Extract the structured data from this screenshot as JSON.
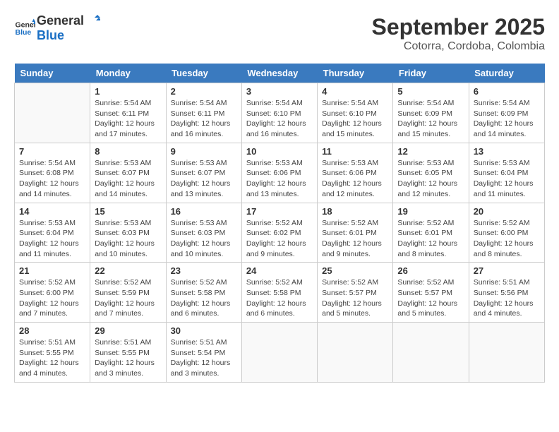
{
  "header": {
    "logo_line1": "General",
    "logo_line2": "Blue",
    "month": "September 2025",
    "location": "Cotorra, Cordoba, Colombia"
  },
  "days_of_week": [
    "Sunday",
    "Monday",
    "Tuesday",
    "Wednesday",
    "Thursday",
    "Friday",
    "Saturday"
  ],
  "weeks": [
    [
      {
        "day": "",
        "info": ""
      },
      {
        "day": "1",
        "info": "Sunrise: 5:54 AM\nSunset: 6:11 PM\nDaylight: 12 hours\nand 17 minutes."
      },
      {
        "day": "2",
        "info": "Sunrise: 5:54 AM\nSunset: 6:11 PM\nDaylight: 12 hours\nand 16 minutes."
      },
      {
        "day": "3",
        "info": "Sunrise: 5:54 AM\nSunset: 6:10 PM\nDaylight: 12 hours\nand 16 minutes."
      },
      {
        "day": "4",
        "info": "Sunrise: 5:54 AM\nSunset: 6:10 PM\nDaylight: 12 hours\nand 15 minutes."
      },
      {
        "day": "5",
        "info": "Sunrise: 5:54 AM\nSunset: 6:09 PM\nDaylight: 12 hours\nand 15 minutes."
      },
      {
        "day": "6",
        "info": "Sunrise: 5:54 AM\nSunset: 6:09 PM\nDaylight: 12 hours\nand 14 minutes."
      }
    ],
    [
      {
        "day": "7",
        "info": "Sunrise: 5:54 AM\nSunset: 6:08 PM\nDaylight: 12 hours\nand 14 minutes."
      },
      {
        "day": "8",
        "info": "Sunrise: 5:53 AM\nSunset: 6:07 PM\nDaylight: 12 hours\nand 14 minutes."
      },
      {
        "day": "9",
        "info": "Sunrise: 5:53 AM\nSunset: 6:07 PM\nDaylight: 12 hours\nand 13 minutes."
      },
      {
        "day": "10",
        "info": "Sunrise: 5:53 AM\nSunset: 6:06 PM\nDaylight: 12 hours\nand 13 minutes."
      },
      {
        "day": "11",
        "info": "Sunrise: 5:53 AM\nSunset: 6:06 PM\nDaylight: 12 hours\nand 12 minutes."
      },
      {
        "day": "12",
        "info": "Sunrise: 5:53 AM\nSunset: 6:05 PM\nDaylight: 12 hours\nand 12 minutes."
      },
      {
        "day": "13",
        "info": "Sunrise: 5:53 AM\nSunset: 6:04 PM\nDaylight: 12 hours\nand 11 minutes."
      }
    ],
    [
      {
        "day": "14",
        "info": "Sunrise: 5:53 AM\nSunset: 6:04 PM\nDaylight: 12 hours\nand 11 minutes."
      },
      {
        "day": "15",
        "info": "Sunrise: 5:53 AM\nSunset: 6:03 PM\nDaylight: 12 hours\nand 10 minutes."
      },
      {
        "day": "16",
        "info": "Sunrise: 5:53 AM\nSunset: 6:03 PM\nDaylight: 12 hours\nand 10 minutes."
      },
      {
        "day": "17",
        "info": "Sunrise: 5:52 AM\nSunset: 6:02 PM\nDaylight: 12 hours\nand 9 minutes."
      },
      {
        "day": "18",
        "info": "Sunrise: 5:52 AM\nSunset: 6:01 PM\nDaylight: 12 hours\nand 9 minutes."
      },
      {
        "day": "19",
        "info": "Sunrise: 5:52 AM\nSunset: 6:01 PM\nDaylight: 12 hours\nand 8 minutes."
      },
      {
        "day": "20",
        "info": "Sunrise: 5:52 AM\nSunset: 6:00 PM\nDaylight: 12 hours\nand 8 minutes."
      }
    ],
    [
      {
        "day": "21",
        "info": "Sunrise: 5:52 AM\nSunset: 6:00 PM\nDaylight: 12 hours\nand 7 minutes."
      },
      {
        "day": "22",
        "info": "Sunrise: 5:52 AM\nSunset: 5:59 PM\nDaylight: 12 hours\nand 7 minutes."
      },
      {
        "day": "23",
        "info": "Sunrise: 5:52 AM\nSunset: 5:58 PM\nDaylight: 12 hours\nand 6 minutes."
      },
      {
        "day": "24",
        "info": "Sunrise: 5:52 AM\nSunset: 5:58 PM\nDaylight: 12 hours\nand 6 minutes."
      },
      {
        "day": "25",
        "info": "Sunrise: 5:52 AM\nSunset: 5:57 PM\nDaylight: 12 hours\nand 5 minutes."
      },
      {
        "day": "26",
        "info": "Sunrise: 5:52 AM\nSunset: 5:57 PM\nDaylight: 12 hours\nand 5 minutes."
      },
      {
        "day": "27",
        "info": "Sunrise: 5:51 AM\nSunset: 5:56 PM\nDaylight: 12 hours\nand 4 minutes."
      }
    ],
    [
      {
        "day": "28",
        "info": "Sunrise: 5:51 AM\nSunset: 5:55 PM\nDaylight: 12 hours\nand 4 minutes."
      },
      {
        "day": "29",
        "info": "Sunrise: 5:51 AM\nSunset: 5:55 PM\nDaylight: 12 hours\nand 3 minutes."
      },
      {
        "day": "30",
        "info": "Sunrise: 5:51 AM\nSunset: 5:54 PM\nDaylight: 12 hours\nand 3 minutes."
      },
      {
        "day": "",
        "info": ""
      },
      {
        "day": "",
        "info": ""
      },
      {
        "day": "",
        "info": ""
      },
      {
        "day": "",
        "info": ""
      }
    ]
  ]
}
